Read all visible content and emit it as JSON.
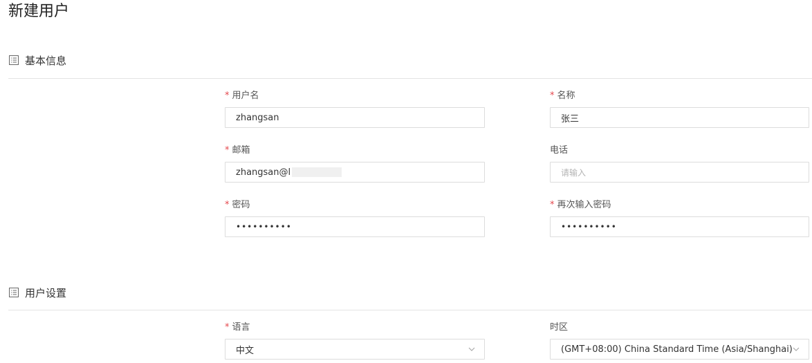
{
  "page": {
    "title": "新建用户"
  },
  "sections": {
    "basic": {
      "title": "基本信息",
      "icon": "list-icon"
    },
    "settings": {
      "title": "用户设置",
      "icon": "list-icon"
    }
  },
  "form": {
    "username": {
      "label": "用户名",
      "required": true,
      "value": "zhangsan"
    },
    "name": {
      "label": "名称",
      "required": true,
      "value": "张三"
    },
    "email": {
      "label": "邮箱",
      "required": true,
      "value": "zhangsan@l"
    },
    "phone": {
      "label": "电话",
      "required": false,
      "value": "",
      "placeholder": "请输入"
    },
    "password": {
      "label": "密码",
      "required": true,
      "value": "••••••••••"
    },
    "confirm_password": {
      "label": "再次输入密码",
      "required": true,
      "value": "••••••••••"
    },
    "language": {
      "label": "语言",
      "required": true,
      "value": "中文"
    },
    "timezone": {
      "label": "时区",
      "required": false,
      "value": "(GMT+08:00) China Standard Time (Asia/Shanghai)"
    }
  },
  "required_mark": "*",
  "colors": {
    "required": "#e5484d",
    "border": "#dcdcdc",
    "divider": "#e4e4e4",
    "placeholder": "#b4b4b4"
  }
}
